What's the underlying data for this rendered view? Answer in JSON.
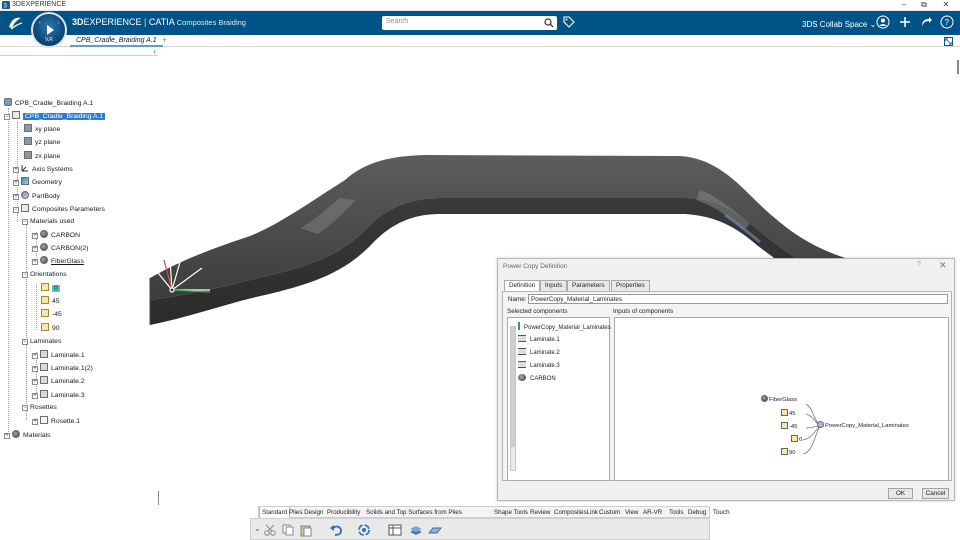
{
  "os_bar": {
    "title": "3DEXPERIENCE",
    "minimize": "–",
    "restore": "⧉",
    "close": "✕"
  },
  "header": {
    "brand_bold": "3D",
    "brand_rest": "EXPERIENCE",
    "separator": " | ",
    "product": "CATIA",
    "app_name": "Composites Braiding",
    "compass_label": "V,R",
    "search_placeholder": "Search",
    "collab_space": "3DS Collab Space",
    "accent": "#005387"
  },
  "tabbar": {
    "tab_label": "CPB_Cradle_Braiding A.1",
    "add_label": "+",
    "collapse": "‹"
  },
  "tree": {
    "root": "CPB_Cradle_Braiding A.1",
    "part": "CPB_Cradle_Braiding A.1",
    "planes": [
      "xy plane",
      "yz plane",
      "zx plane"
    ],
    "axis_systems": "Axis Systems",
    "geometry": "Geometry",
    "partbody": "PartBody",
    "composites_parameters": "Composites Parameters",
    "materials_used": "Materials used",
    "materials": [
      "CARBON",
      "CARBON(2)",
      "FiberGlass"
    ],
    "orientations_label": "Orientations",
    "orientations": [
      "0",
      "45",
      "-45",
      "90"
    ],
    "laminates_label": "Laminates",
    "laminates": [
      "Laminate.1",
      "Laminate.1(2)",
      "Laminate.2",
      "Laminate.3"
    ],
    "rosettes_label": "Rosettes",
    "rosettes": [
      "Rosette.1"
    ],
    "materials_root": "Materials"
  },
  "dialog": {
    "title": "Power Copy Definition",
    "help": "?",
    "close": "✕",
    "tabs": [
      "Definition",
      "Inputs",
      "Parameters",
      "Properties"
    ],
    "name_label": "Name:",
    "name_value": "PowerCopy_Material_Laminates",
    "selected_components_label": "Selected components",
    "inputs_of_components_label": "Inputs of components",
    "selected_components": [
      "PowerCopy_Material_Laminates",
      "Laminate.1",
      "Laminate.2",
      "Laminate.3",
      "CARBON"
    ],
    "graph_inputs": [
      "FiberGlass",
      "45",
      "-45",
      "0",
      "90"
    ],
    "graph_output": "PowerCopy_Material_Laminates",
    "ok": "OK",
    "cancel": "Cancel"
  },
  "action_bar": {
    "tabs": [
      "Standard",
      "Plies Design",
      "Producibility",
      "Solids and Top Surfaces from Plies",
      "Shape Tools",
      "Review",
      "CompositesLink",
      "Custom",
      "View",
      "AR-VR",
      "Tools",
      "Debug",
      "Touch"
    ],
    "active_tab": "Standard"
  }
}
